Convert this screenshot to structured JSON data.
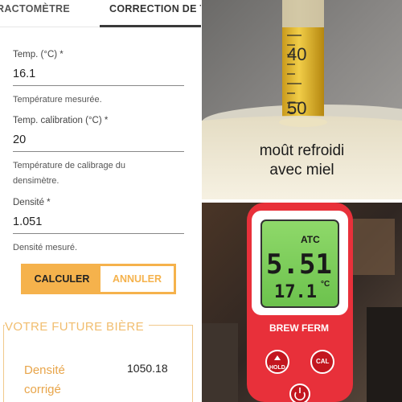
{
  "tabs": [
    {
      "label": "RACTOMÈTRE"
    },
    {
      "label": "CORRECTION DE T"
    }
  ],
  "form": {
    "temp": {
      "label": "Temp. (°C) *",
      "value": "16.1",
      "help": "Température mesurée."
    },
    "calibration": {
      "label": "Temp. calibration (°C) *",
      "value": "20",
      "help_line1": "Température de calibrage du",
      "help_line2": "densimètre."
    },
    "density": {
      "label": "Densité *",
      "value": "1.051",
      "help": "Densité mesuré."
    }
  },
  "buttons": {
    "calculate": "CALCULER",
    "cancel": "ANNULER"
  },
  "result": {
    "title": "VOTRE FUTURE BIÈRE",
    "label_line1": "Densité",
    "label_line2": "corrigé",
    "value": "1050.18"
  },
  "photo_top": {
    "scale_top": "40",
    "scale_bottom": "50",
    "caption_line1": "moût refroidi",
    "caption_line2": "avec miel"
  },
  "photo_bottom": {
    "atc": "ATC",
    "reading": "5.51",
    "temperature": "17.1",
    "temp_unit": "°C",
    "brand_left": "BREW",
    "brand_right": "FERM",
    "btn_hold": "HOLD",
    "btn_cal": "CAL"
  },
  "colors": {
    "accent": "#f5b24c",
    "result_text": "#e8a54a",
    "device_red": "#e8303a",
    "lcd_green": "#7fcf5c"
  }
}
